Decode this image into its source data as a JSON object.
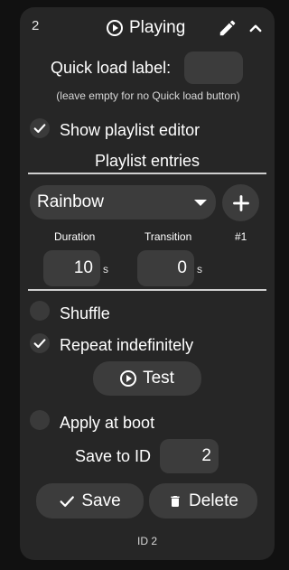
{
  "header": {
    "number": "2",
    "title": "Playing",
    "icons": [
      "play-circle-icon",
      "pencil-icon",
      "chevron-up-icon"
    ]
  },
  "quick_load": {
    "label": "Quick load label:",
    "value": "",
    "hint": "(leave empty for no Quick load button)"
  },
  "show_playlist_editor": {
    "label": "Show playlist editor",
    "checked": true
  },
  "playlist": {
    "heading": "Playlist entries",
    "selected_effect": "Rainbow",
    "duration_label": "Duration",
    "transition_label": "Transition",
    "entry_index": "#1",
    "duration_value": "10",
    "transition_value": "0",
    "unit": "s"
  },
  "options": {
    "shuffle_label": "Shuffle",
    "shuffle_checked": false,
    "repeat_label": "Repeat indefinitely",
    "repeat_checked": true,
    "test_label": "Test",
    "apply_boot_label": "Apply at boot",
    "apply_boot_checked": false,
    "save_to_id_label": "Save to ID",
    "save_to_id_value": "2"
  },
  "actions": {
    "save_label": "Save",
    "delete_label": "Delete"
  },
  "footer": {
    "id_text": "ID 2"
  },
  "colors": {
    "background": "#111111",
    "card": "#262626",
    "control": "#3c3c3c",
    "text": "#ffffff"
  }
}
